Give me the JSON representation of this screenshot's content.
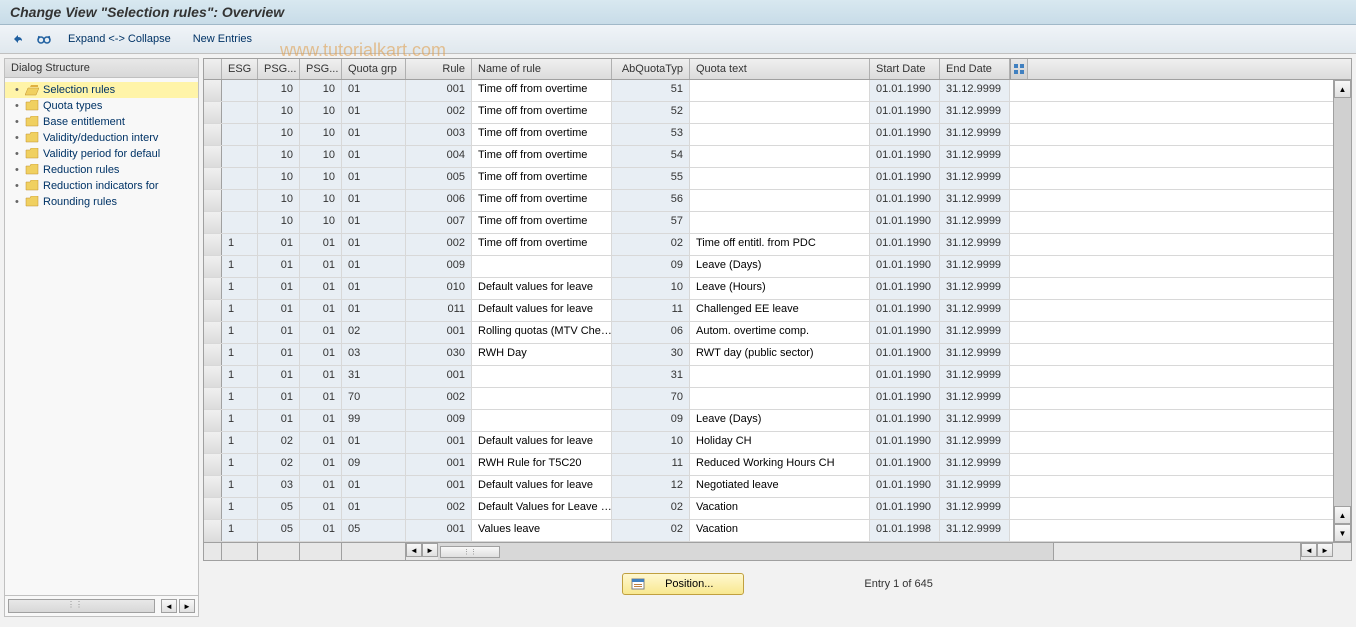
{
  "title": "Change View \"Selection rules\": Overview",
  "toolbar": {
    "expand_collapse": "Expand <-> Collapse",
    "new_entries": "New Entries"
  },
  "watermark": "www.tutorialkart.com",
  "sidebar": {
    "header": "Dialog Structure",
    "items": [
      {
        "label": "Selection rules",
        "selected": true,
        "open": true
      },
      {
        "label": "Quota types",
        "selected": false,
        "open": false
      },
      {
        "label": "Base entitlement",
        "selected": false,
        "open": false
      },
      {
        "label": "Validity/deduction interv",
        "selected": false,
        "open": false
      },
      {
        "label": "Validity period for defaul",
        "selected": false,
        "open": false
      },
      {
        "label": "Reduction rules",
        "selected": false,
        "open": false
      },
      {
        "label": "Reduction indicators for",
        "selected": false,
        "open": false
      },
      {
        "label": "Rounding rules",
        "selected": false,
        "open": false
      }
    ]
  },
  "table": {
    "headers": {
      "esg": "ESG",
      "psg1": "PSG...",
      "psg2": "PSG...",
      "quota_grp": "Quota grp",
      "rule": "Rule",
      "name": "Name of rule",
      "abq": "AbQuotaTyp",
      "qtext": "Quota text",
      "start": "Start Date",
      "end": "End Date"
    },
    "rows": [
      {
        "esg": "",
        "psg1": "10",
        "psg2": "10",
        "qgrp": "01",
        "rule": "001",
        "name": "Time off from overtime",
        "abq": "51",
        "qtext": "",
        "start": "01.01.1990",
        "end": "31.12.9999"
      },
      {
        "esg": "",
        "psg1": "10",
        "psg2": "10",
        "qgrp": "01",
        "rule": "002",
        "name": "Time off from overtime",
        "abq": "52",
        "qtext": "",
        "start": "01.01.1990",
        "end": "31.12.9999"
      },
      {
        "esg": "",
        "psg1": "10",
        "psg2": "10",
        "qgrp": "01",
        "rule": "003",
        "name": "Time off from overtime",
        "abq": "53",
        "qtext": "",
        "start": "01.01.1990",
        "end": "31.12.9999"
      },
      {
        "esg": "",
        "psg1": "10",
        "psg2": "10",
        "qgrp": "01",
        "rule": "004",
        "name": "Time off from overtime",
        "abq": "54",
        "qtext": "",
        "start": "01.01.1990",
        "end": "31.12.9999"
      },
      {
        "esg": "",
        "psg1": "10",
        "psg2": "10",
        "qgrp": "01",
        "rule": "005",
        "name": "Time off from overtime",
        "abq": "55",
        "qtext": "",
        "start": "01.01.1990",
        "end": "31.12.9999"
      },
      {
        "esg": "",
        "psg1": "10",
        "psg2": "10",
        "qgrp": "01",
        "rule": "006",
        "name": "Time off from overtime",
        "abq": "56",
        "qtext": "",
        "start": "01.01.1990",
        "end": "31.12.9999"
      },
      {
        "esg": "",
        "psg1": "10",
        "psg2": "10",
        "qgrp": "01",
        "rule": "007",
        "name": "Time off from overtime",
        "abq": "57",
        "qtext": "",
        "start": "01.01.1990",
        "end": "31.12.9999"
      },
      {
        "esg": "1",
        "psg1": "01",
        "psg2": "01",
        "qgrp": "01",
        "rule": "002",
        "name": "Time off from overtime",
        "abq": "02",
        "qtext": "Time off entitl. from PDC",
        "start": "01.01.1990",
        "end": "31.12.9999"
      },
      {
        "esg": "1",
        "psg1": "01",
        "psg2": "01",
        "qgrp": "01",
        "rule": "009",
        "name": "",
        "abq": "09",
        "qtext": "Leave (Days)",
        "start": "01.01.1990",
        "end": "31.12.9999"
      },
      {
        "esg": "1",
        "psg1": "01",
        "psg2": "01",
        "qgrp": "01",
        "rule": "010",
        "name": "Default values for leave",
        "abq": "10",
        "qtext": "Leave (Hours)",
        "start": "01.01.1990",
        "end": "31.12.9999"
      },
      {
        "esg": "1",
        "psg1": "01",
        "psg2": "01",
        "qgrp": "01",
        "rule": "011",
        "name": "Default values for leave",
        "abq": "11",
        "qtext": "Challenged EE leave",
        "start": "01.01.1990",
        "end": "31.12.9999"
      },
      {
        "esg": "1",
        "psg1": "01",
        "psg2": "01",
        "qgrp": "02",
        "rule": "001",
        "name": "Rolling quotas (MTV Che…",
        "abq": "06",
        "qtext": "Autom. overtime comp.",
        "start": "01.01.1990",
        "end": "31.12.9999"
      },
      {
        "esg": "1",
        "psg1": "01",
        "psg2": "01",
        "qgrp": "03",
        "rule": "030",
        "name": "RWH Day",
        "abq": "30",
        "qtext": "RWT day (public sector)",
        "start": "01.01.1900",
        "end": "31.12.9999"
      },
      {
        "esg": "1",
        "psg1": "01",
        "psg2": "01",
        "qgrp": "31",
        "rule": "001",
        "name": "",
        "abq": "31",
        "qtext": "",
        "start": "01.01.1990",
        "end": "31.12.9999"
      },
      {
        "esg": "1",
        "psg1": "01",
        "psg2": "01",
        "qgrp": "70",
        "rule": "002",
        "name": "",
        "abq": "70",
        "qtext": "",
        "start": "01.01.1990",
        "end": "31.12.9999"
      },
      {
        "esg": "1",
        "psg1": "01",
        "psg2": "01",
        "qgrp": "99",
        "rule": "009",
        "name": "",
        "abq": "09",
        "qtext": "Leave (Days)",
        "start": "01.01.1990",
        "end": "31.12.9999"
      },
      {
        "esg": "1",
        "psg1": "02",
        "psg2": "01",
        "qgrp": "01",
        "rule": "001",
        "name": "Default values for leave",
        "abq": "10",
        "qtext": "Holiday CH",
        "start": "01.01.1990",
        "end": "31.12.9999"
      },
      {
        "esg": "1",
        "psg1": "02",
        "psg2": "01",
        "qgrp": "09",
        "rule": "001",
        "name": "RWH Rule for T5C20",
        "abq": "11",
        "qtext": "Reduced Working Hours CH",
        "start": "01.01.1900",
        "end": "31.12.9999"
      },
      {
        "esg": "1",
        "psg1": "03",
        "psg2": "01",
        "qgrp": "01",
        "rule": "001",
        "name": "Default values for leave",
        "abq": "12",
        "qtext": "Negotiated leave",
        "start": "01.01.1990",
        "end": "31.12.9999"
      },
      {
        "esg": "1",
        "psg1": "05",
        "psg2": "01",
        "qgrp": "01",
        "rule": "002",
        "name": "Default Values for Leave …",
        "abq": "02",
        "qtext": "Vacation",
        "start": "01.01.1990",
        "end": "31.12.9999"
      },
      {
        "esg": "1",
        "psg1": "05",
        "psg2": "01",
        "qgrp": "05",
        "rule": "001",
        "name": "Values leave",
        "abq": "02",
        "qtext": "Vacation",
        "start": "01.01.1998",
        "end": "31.12.9999"
      }
    ]
  },
  "footer": {
    "position_label": "Position...",
    "entry_text": "Entry 1 of 645"
  }
}
